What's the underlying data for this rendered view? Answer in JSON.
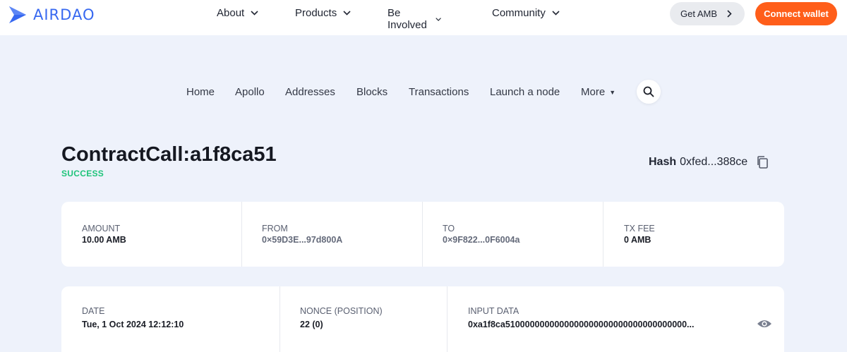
{
  "header": {
    "brand": "AIRDAO",
    "nav": [
      {
        "label": "About"
      },
      {
        "label": "Products"
      },
      {
        "label": "Be Involved"
      },
      {
        "label": "Community"
      }
    ],
    "get_amb_label": "Get AMB",
    "connect_label": "Connect wallet",
    "colors": {
      "brand": "#3768f0",
      "cta": "#ff5e1a"
    }
  },
  "subnav": {
    "items": [
      "Home",
      "Apollo",
      "Addresses",
      "Blocks",
      "Transactions",
      "Launch a node"
    ],
    "more_label": "More"
  },
  "transaction": {
    "title": "ContractCall:a1f8ca51",
    "status": "SUCCESS",
    "hash_label": "Hash",
    "hash_value": "0xfed...388ce",
    "summary": [
      {
        "label": "AMOUNT",
        "value": "10.00 AMB"
      },
      {
        "label": "FROM",
        "value": "0×59D3E...97d800A"
      },
      {
        "label": "TO",
        "value": "0×9F822...0F6004a"
      },
      {
        "label": "TX FEE",
        "value": "0 AMB"
      }
    ],
    "details": [
      {
        "label": "DATE",
        "value": "Tue, 1 Oct 2024 12:12:10"
      },
      {
        "label": "NONCE (POSITION)",
        "value": "22 (0)"
      },
      {
        "label": "INPUT DATA",
        "value": "0xa1f8ca5100000000000000000000000000000000000..."
      }
    ],
    "status_color": "#1fc47a"
  }
}
